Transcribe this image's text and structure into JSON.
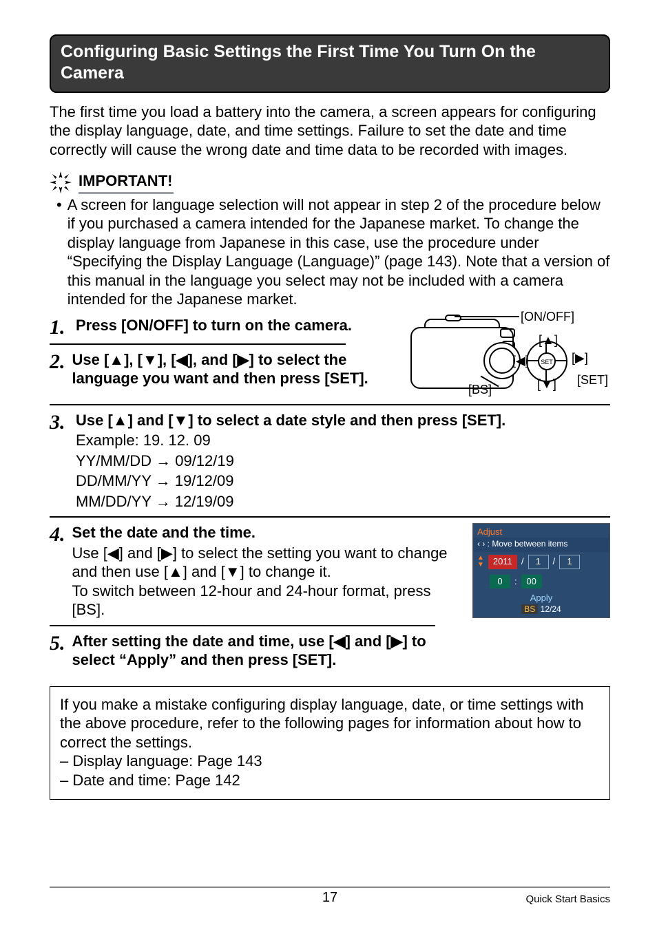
{
  "sectionTitle": "Configuring Basic Settings the First Time You Turn On the Camera",
  "introPara": "The first time you load a battery into the camera, a screen appears for configuring the display language, date, and time settings. Failure to set the date and time correctly will cause the wrong date and time data to be recorded with images.",
  "importantLabel": "IMPORTANT!",
  "importantText": "A screen for language selection will not appear in step 2 of the procedure below if you purchased a camera intended for the Japanese market. To change the display language from Japanese in this case, use the procedure under “Specifying the Display Language (Language)” (page 143). Note that a version of this manual in the language you select may not be included with a camera intended for the Japanese market.",
  "diagram": {
    "onoff": "[ON/OFF]",
    "up": "[▲]",
    "down": "[▼]",
    "left": "[◀]",
    "right": "[▶]",
    "set": "[SET]",
    "bs": "[BS]",
    "setInner": "SET"
  },
  "steps": {
    "s1": {
      "num": "1.",
      "head": "Press [ON/OFF] to turn on the camera."
    },
    "s2": {
      "num": "2.",
      "head": "Use [▲], [▼], [◀], and [▶] to select the language you want and then press [SET]."
    },
    "s3": {
      "num": "3.",
      "head": "Use [▲] and [▼] to select a date style and then press [SET].",
      "example": "Example: 19. 12. 09",
      "l1": "YY/MM/DD → 09/12/19",
      "l2": "DD/MM/YY → 19/12/09",
      "l3": "MM/DD/YY → 12/19/09"
    },
    "s4": {
      "num": "4.",
      "head": "Set the date and the time.",
      "body": "Use [◀] and [▶] to select the setting you want to change and then use [▲] and [▼] to change it.\nTo switch between 12-hour and 24-hour format, press [BS]."
    },
    "s5": {
      "num": "5.",
      "head": "After setting the date and time, use [◀] and [▶] to select “Apply” and then press [SET]."
    }
  },
  "adjustScreen": {
    "title": "Adjust",
    "hint": "‹ › : Move between items",
    "year": "2011",
    "month": "1",
    "day": "1",
    "hour": "0",
    "minute": "00",
    "apply": "Apply",
    "bs": "BS",
    "format": "12/24"
  },
  "noteBox": {
    "intro": "If you make a mistake configuring display language, date, or time settings with the above procedure, refer to the following pages for information about how to correct the settings.",
    "line1": "– Display language: Page 143",
    "line2": "– Date and time: Page 142"
  },
  "footer": {
    "page": "17",
    "section": "Quick Start Basics"
  }
}
